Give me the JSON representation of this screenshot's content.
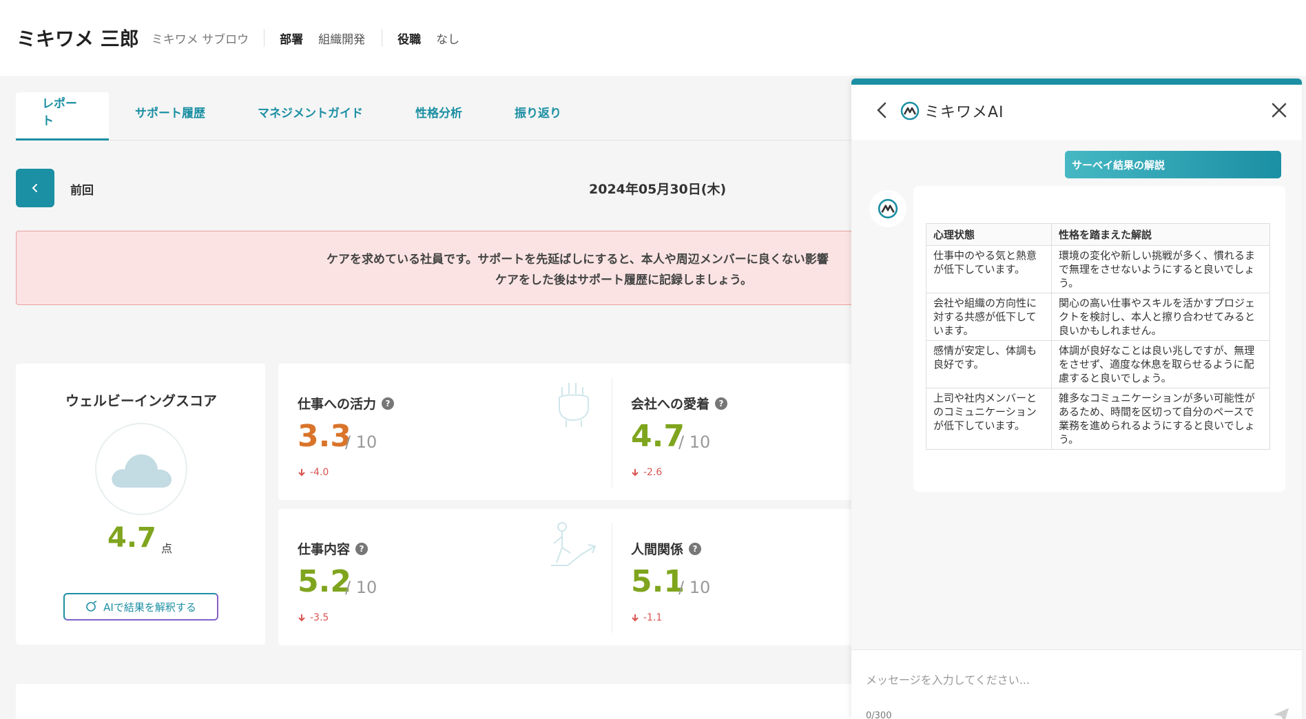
{
  "header": {
    "name": "ミキワメ 三郎",
    "kana": "ミキワメ サブロウ",
    "department_key": "部署",
    "department_value": "組織開発",
    "position_key": "役職",
    "position_value": "なし"
  },
  "tabs": [
    {
      "label": "レポート",
      "active": true
    },
    {
      "label": "サポート履歴"
    },
    {
      "label": "マネジメントガイド"
    },
    {
      "label": "性格分析"
    },
    {
      "label": "振り返り"
    }
  ],
  "nav": {
    "prev_label": "前回",
    "date": "2024年05月30日(木)"
  },
  "alert": {
    "line1": "ケアを求めている社員です。サポートを先延ばしにすると、本人や周辺メンバーに良くない影響",
    "line2": "ケアをした後はサポート履歴に記録しましょう。"
  },
  "wellbeing": {
    "title": "ウェルビーイングスコア",
    "icon": "cloud-icon",
    "score": "4.7",
    "unit": "点",
    "ai_button": "AIで結果を解釈する"
  },
  "metrics": [
    {
      "title": "仕事への活力",
      "score": "3.3",
      "denom": "/ 10",
      "diff": "-4.0",
      "color": "#d9742a",
      "icon": "fist-icon"
    },
    {
      "title": "会社への愛着",
      "score": "4.7",
      "denom": "/ 10",
      "diff": "-2.6",
      "color": "#7fa51e"
    },
    {
      "title": "仕事内容",
      "score": "5.2",
      "denom": "/ 10",
      "diff": "-3.5",
      "color": "#7fa51e",
      "icon": "person-growth-icon"
    },
    {
      "title": "人間関係",
      "score": "5.1",
      "denom": "/ 10",
      "diff": "-1.1",
      "color": "#7fa51e"
    }
  ],
  "ai_panel": {
    "logo_text": "ミキワメAI",
    "tag": "サーベイ結果の解説",
    "table": {
      "headers": [
        "心理状態",
        "性格を踏まえた解説"
      ],
      "rows": [
        [
          "仕事中のやる気と熱意が低下しています。",
          "環境の変化や新しい挑戦が多く、慣れるまで無理をさせないようにすると良いでしょう。"
        ],
        [
          "会社や組織の方向性に対する共感が低下しています。",
          "関心の高い仕事やスキルを活かすプロジェクトを検討し、本人と擦り合わせてみると良いかもしれません。"
        ],
        [
          "感情が安定し、体調も良好です。",
          "体調が良好なことは良い兆しですが、無理をさせず、適度な休息を取らせるように配慮すると良いでしょう。"
        ],
        [
          "上司や社内メンバーとのコミュニケーションが低下しています。",
          "雑多なコミュニケーションが多い可能性があるため、時間を区切って自分のペースで業務を進められるようにすると良いでしょう。"
        ]
      ]
    },
    "input_placeholder": "メッセージを入力してください...",
    "char_count": "0/300"
  },
  "colors": {
    "accent": "#1b8fa3",
    "good": "#7fa51e",
    "warn": "#d9742a",
    "down": "#d9534f"
  }
}
